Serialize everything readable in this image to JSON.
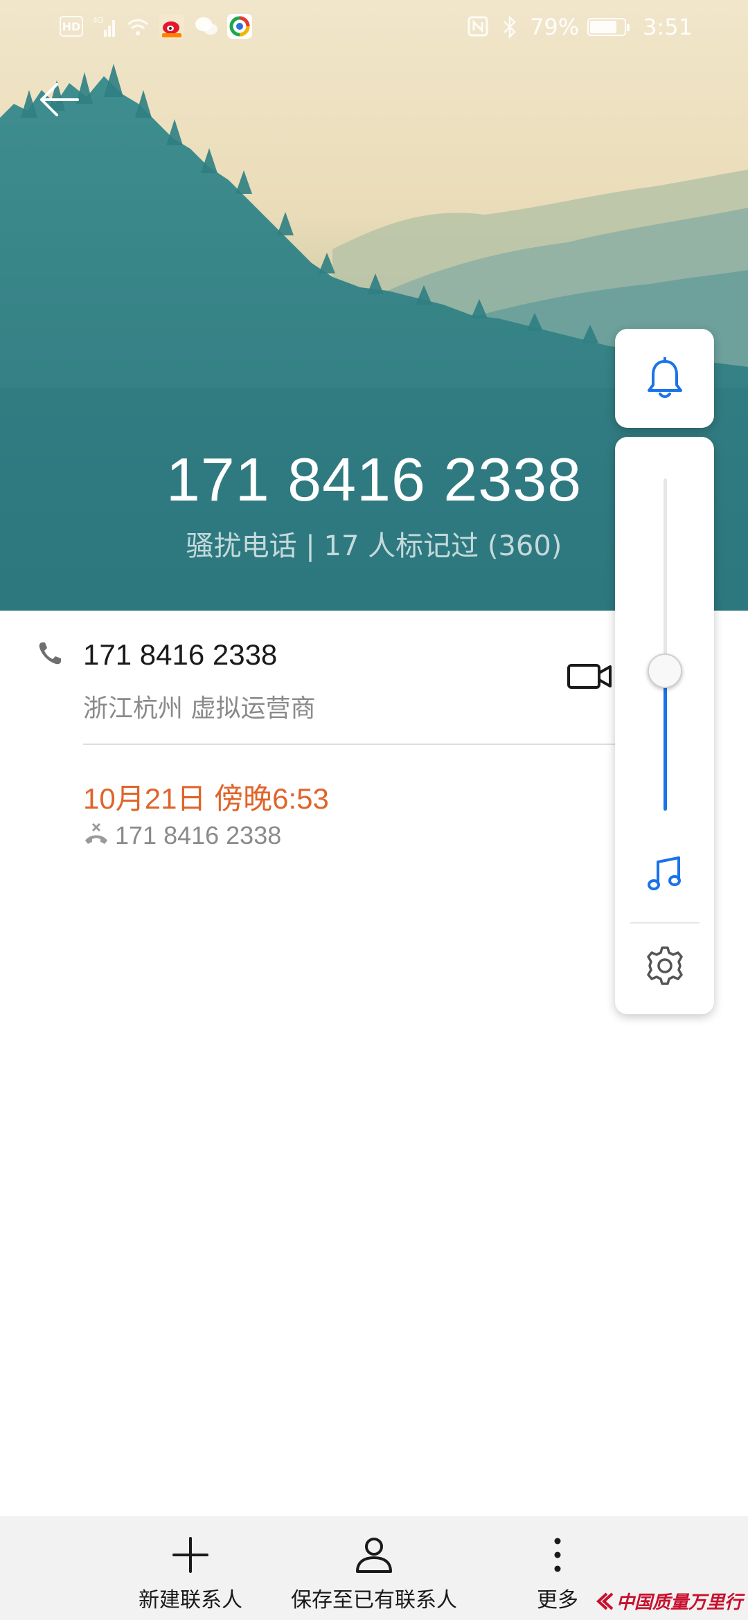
{
  "status_bar": {
    "hd_label": "HD",
    "network_label": "4G",
    "battery_percent": "79%",
    "battery_level": 0.79,
    "time": "3:51",
    "icons": [
      "hd-icon",
      "signal-icon",
      "wifi-icon",
      "weibo-icon",
      "wechat-icon",
      "browser-icon",
      "nfc-icon",
      "bluetooth-icon",
      "battery-icon"
    ]
  },
  "header": {
    "phone_number": "171 8416 2338",
    "tag_line": "骚扰电话 | 17 人标记过 (360)",
    "back_icon": "arrow-left-icon"
  },
  "contact_row": {
    "number": "171 8416 2338",
    "location": "浙江杭州 虚拟运营商",
    "icon": "phone-icon",
    "video_icon": "video-call-icon"
  },
  "call_log": {
    "date": "10月21日 傍晚6:53",
    "number": "171 8416 2338",
    "status_icon": "missed-call-icon",
    "date_color": "#e0642a"
  },
  "volume_panel": {
    "ring_icon": "bell-icon",
    "level": 0.42,
    "music_icon": "music-note-icon",
    "settings_icon": "gear-icon",
    "accent_color": "#1a73e8"
  },
  "bottom_bar": {
    "new_contact": "新建联系人",
    "save_existing": "保存至已有联系人",
    "more": "更多"
  },
  "watermark": "中国质量万里行"
}
